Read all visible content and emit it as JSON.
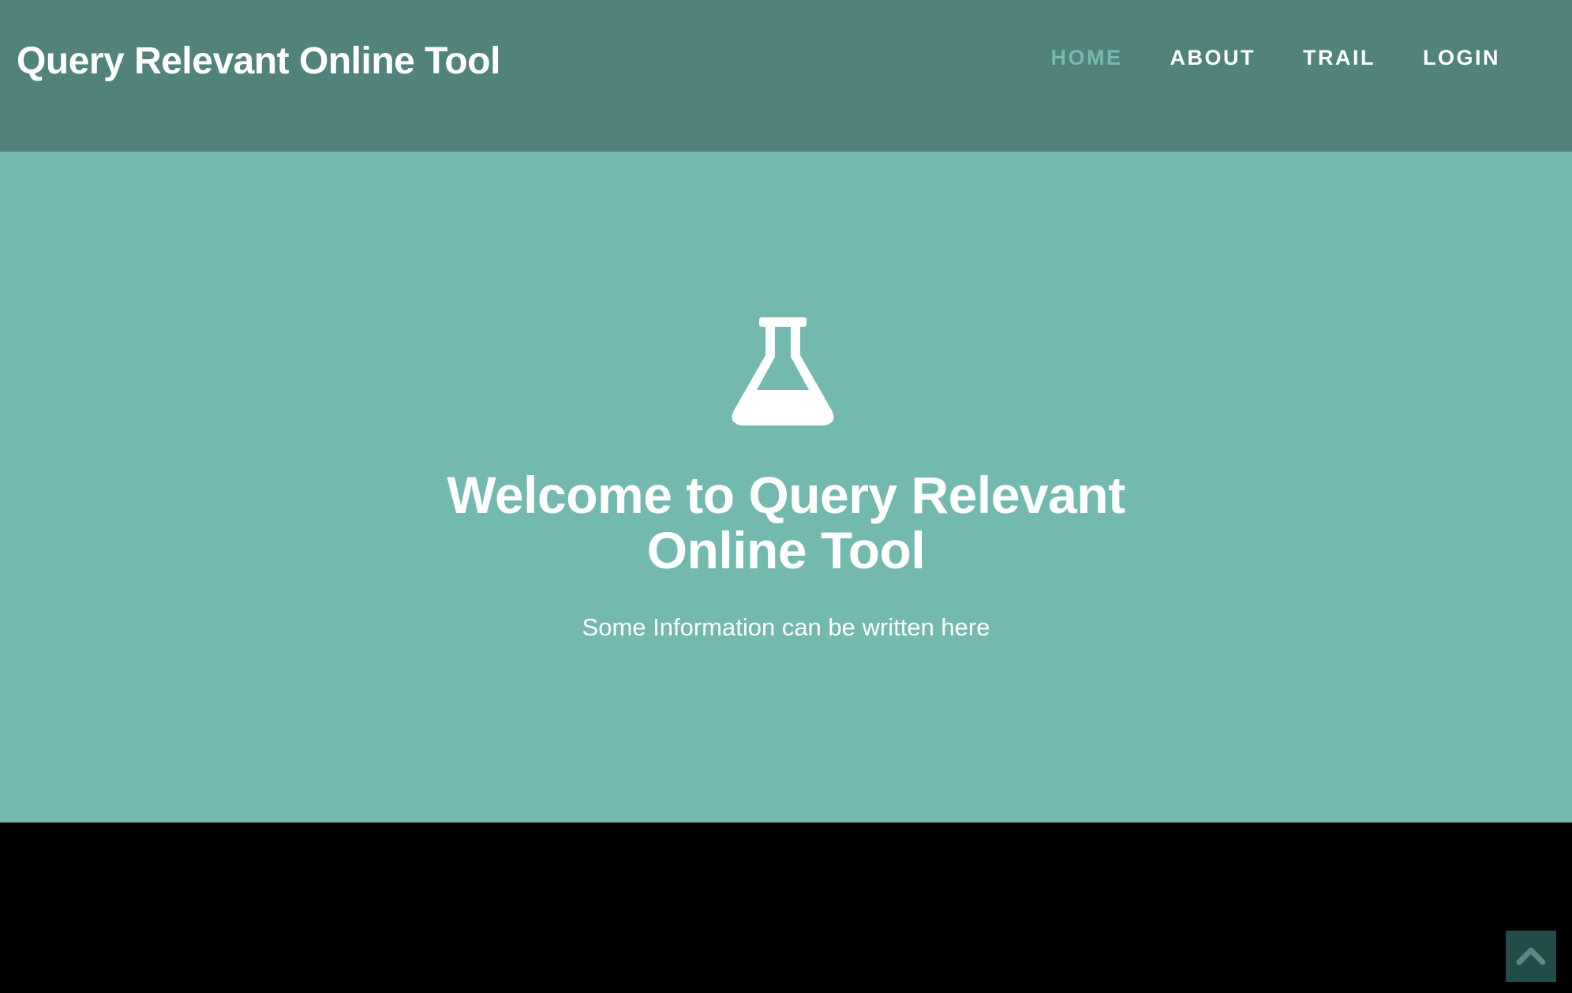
{
  "header": {
    "brand": "Query Relevant Online Tool",
    "nav": [
      {
        "label": "HOME",
        "active": true
      },
      {
        "label": "ABOUT",
        "active": false
      },
      {
        "label": "TRAIL",
        "active": false
      },
      {
        "label": "LOGIN",
        "active": false
      }
    ]
  },
  "hero": {
    "icon": "flask-icon",
    "title_line1": "Welcome to Query Relevant",
    "title_line2": "Online Tool",
    "subtitle": "Some Information can be written here"
  },
  "scroll_top": {
    "icon": "chevron-up-icon"
  },
  "colors": {
    "header_bg": "#51827b",
    "hero_bg": "#73b9af",
    "nav_active": "#74bab0",
    "scroll_btn_bg": "#214c49",
    "footer_bg": "#010101"
  }
}
